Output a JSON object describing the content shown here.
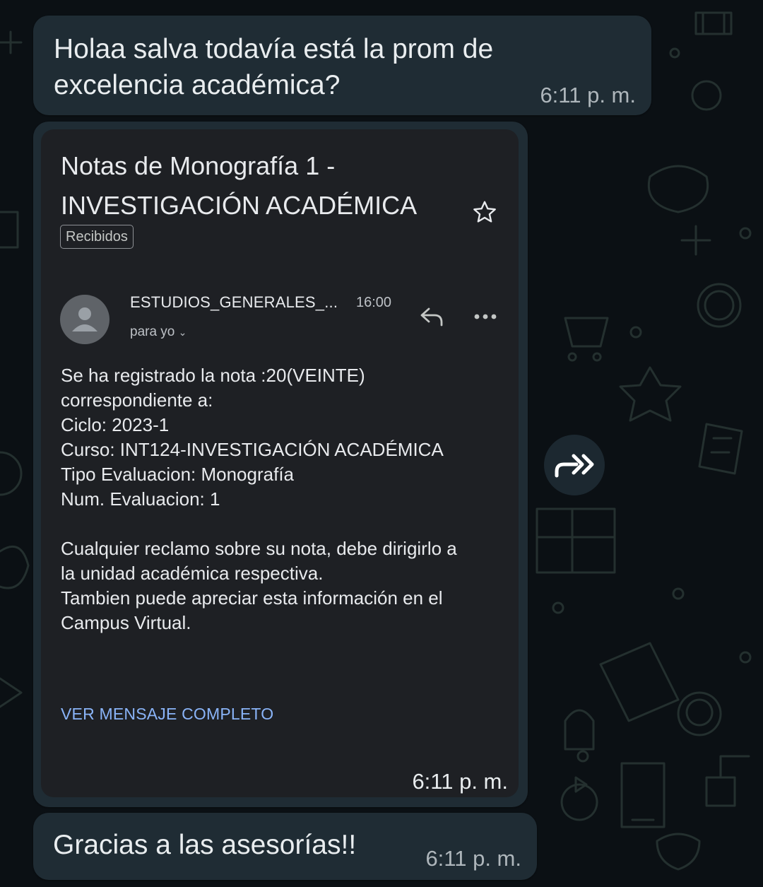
{
  "messages": [
    {
      "text": "Holaa salva todavía está la prom de excelencia académica?",
      "time": "6:11 p. m."
    },
    {
      "time": "6:11 p. m.",
      "email": {
        "subject": "Notas de Monografía 1 - INVESTIGACIÓN ACADÉMICA",
        "label": "Recibidos",
        "sender": "ESTUDIOS_GENERALES_...",
        "time": "16:00",
        "recipient": "para yo",
        "body": [
          "Se ha registrado la nota :20(VEINTE)",
          "correspondiente a:",
          "Ciclo: 2023-1",
          "Curso: INT124-INVESTIGACIÓN ACADÉMICA",
          "Tipo Evaluacion: Monografía",
          "Num. Evaluacion: 1",
          "",
          "Cualquier reclamo sobre su nota, debe dirigirlo a",
          "la unidad académica respectiva.",
          "Tambien puede apreciar esta información en el",
          "Campus Virtual."
        ],
        "view_full": "VER MENSAJE COMPLETO"
      }
    },
    {
      "text": "Gracias a las asesorías!!",
      "time": "6:11 p. m."
    }
  ],
  "icons": {
    "star": "star-outline-icon",
    "reply": "reply-arrow-icon",
    "more": "more-horizontal-icon",
    "avatar": "person-avatar-icon",
    "forward": "forward-icon"
  },
  "colors": {
    "background": "#0b1014",
    "bubble": "#1f2c34",
    "email_card": "#1e2024",
    "link": "#8ab4f8"
  }
}
